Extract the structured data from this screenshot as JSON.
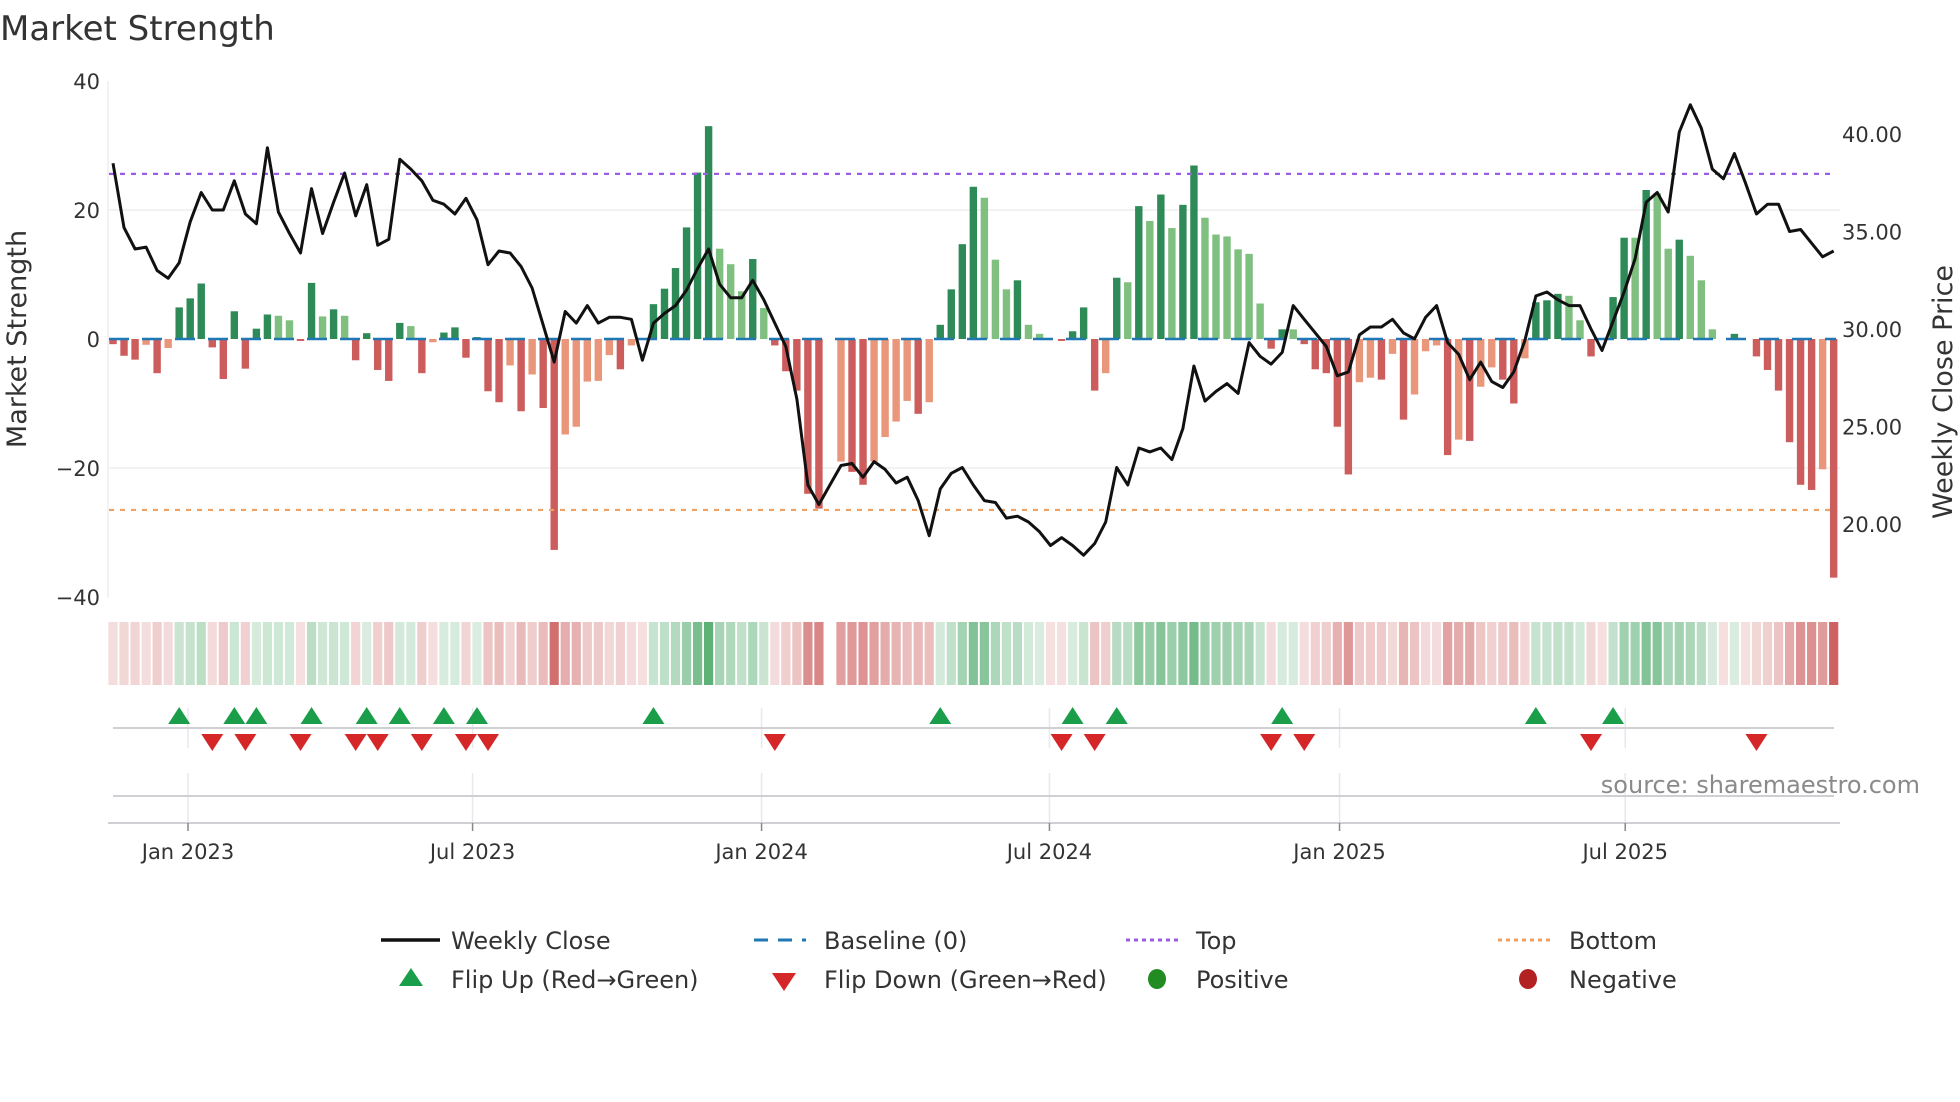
{
  "title": "Market Strength",
  "source": "source: sharemaestro.com",
  "colors": {
    "pos_dark": "#2e8b57",
    "pos_light": "#7fbf7f",
    "neg_dark": "#cd5c5c",
    "neg_light": "#e9967a",
    "line": "#111111",
    "baseline": "#1f77b4",
    "top": "#9b5de5",
    "bottom": "#f0a060",
    "flip_up": "#1a9e4a",
    "flip_down": "#d62728",
    "positive": "#228b22",
    "negative": "#b22222"
  },
  "legend": {
    "weekly_close": "Weekly Close",
    "baseline": "Baseline (0)",
    "top": "Top",
    "bottom": "Bottom",
    "flip_up": "Flip Up (Red→Green)",
    "flip_down": "Flip Down (Green→Red)",
    "positive": "Positive",
    "negative": "Negative"
  },
  "chart_data": {
    "type": "bar+line",
    "title": "Market Strength",
    "ylabel": "Market Strength",
    "ylabel_right": "Weekly Close Price",
    "ylim": [
      -40,
      40
    ],
    "ylim_right": [
      16.2,
      42.7
    ],
    "yticks": [
      "40",
      "20",
      "0",
      "−20",
      "−40"
    ],
    "yticks_values": [
      40,
      20,
      0,
      -20,
      -40
    ],
    "yticks_right": [
      "40.00",
      "35.00",
      "30.00",
      "25.00",
      "20.00"
    ],
    "yticks_right_values": [
      40,
      35,
      30,
      25,
      20
    ],
    "top_level": 25.6,
    "bottom_level": -26.5,
    "x_unit": "week index",
    "xticks": [
      {
        "label": "Jan 2023",
        "week": 6.8
      },
      {
        "label": "Jul 2023",
        "week": 32.6
      },
      {
        "label": "Jan 2024",
        "week": 58.8
      },
      {
        "label": "Jul 2024",
        "week": 84.9
      },
      {
        "label": "Jan 2025",
        "week": 111.2
      },
      {
        "label": "Jul 2025",
        "week": 137.1
      }
    ],
    "strength": [
      -0.8,
      -2.6,
      -3.2,
      -0.9,
      -5.3,
      -1.4,
      4.9,
      6.3,
      8.6,
      -1.3,
      -6.2,
      4.3,
      -4.6,
      1.6,
      3.8,
      3.6,
      2.9,
      -0.3,
      8.7,
      3.5,
      4.6,
      3.6,
      -3.3,
      0.9,
      -4.8,
      -6.5,
      2.5,
      2,
      -5.3,
      -0.5,
      1,
      1.8,
      -2.9,
      0.3,
      -8.1,
      -9.8,
      -4.1,
      -11.2,
      -5.5,
      -10.7,
      -32.7,
      -14.8,
      -13.6,
      -6.6,
      -6.5,
      -2.5,
      -4.7,
      -1,
      0,
      5.4,
      7.8,
      11,
      17.3,
      25.8,
      33,
      14,
      11.6,
      7.4,
      12.4,
      4.8,
      -1,
      -5,
      -8,
      -24,
      -26.3,
      null,
      -19,
      -20.6,
      -22.6,
      -19,
      -15.2,
      -12.8,
      -9.6,
      -11.6,
      -9.8,
      2.2,
      7.7,
      14.7,
      23.6,
      21.9,
      12.3,
      7.7,
      9.1,
      2.2,
      0.8,
      0,
      -0.3,
      1.2,
      4.9,
      -8,
      -5.3,
      9.5,
      8.8,
      20.6,
      18.3,
      22.4,
      17.2,
      20.8,
      26.9,
      18.8,
      16.2,
      15.9,
      13.9,
      13.2,
      5.5,
      -1.5,
      1.5,
      1.5,
      -0.8,
      -4.7,
      -5.3,
      -13.6,
      -21,
      -6.7,
      -6,
      -6.3,
      -2.3,
      -12.5,
      -8.6,
      -1.9,
      -1,
      -18,
      -15.6,
      -15.8,
      -7.4,
      -4.4,
      -6.3,
      -10,
      -3,
      5.7,
      6,
      7,
      6.7,
      2.9,
      -2.7,
      0,
      6.5,
      15.7,
      15.7,
      23.1,
      22.6,
      14,
      15.4,
      12.9,
      9.1,
      1.5,
      0,
      0.8,
      0,
      -2.7,
      -4.8,
      -8,
      -16,
      -22.6,
      -23.4,
      -20.2,
      -37
    ],
    "weekly_close": [
      38.5,
      35.2,
      34.1,
      34.2,
      33.0,
      32.6,
      33.4,
      35.5,
      37.0,
      36.1,
      36.1,
      37.6,
      35.9,
      35.4,
      39.3,
      36.0,
      34.9,
      33.9,
      37.2,
      34.9,
      36.5,
      38.0,
      35.8,
      37.4,
      34.3,
      34.6,
      38.7,
      38.2,
      37.6,
      36.6,
      36.4,
      35.9,
      36.7,
      35.6,
      33.3,
      34.0,
      33.9,
      33.2,
      32.1,
      30.2,
      28.3,
      30.9,
      30.3,
      31.2,
      30.3,
      30.6,
      30.6,
      30.5,
      28.4,
      30.3,
      30.8,
      31.2,
      32.0,
      33.1,
      34.1,
      32.3,
      31.6,
      31.6,
      32.5,
      31.5,
      30.3,
      29.1,
      26.4,
      22.0,
      21.0,
      22.0,
      23.0,
      23.1,
      22.4,
      23.2,
      22.8,
      22.1,
      22.4,
      21.2,
      19.4,
      21.8,
      22.6,
      22.9,
      22.0,
      21.2,
      21.1,
      20.3,
      20.4,
      20.1,
      19.6,
      18.9,
      19.3,
      18.9,
      18.4,
      19.0,
      20.1,
      22.9,
      22.0,
      23.9,
      23.7,
      23.9,
      23.3,
      24.9,
      28.1,
      26.3,
      26.8,
      27.2,
      26.7,
      29.3,
      28.6,
      28.2,
      28.8,
      31.2,
      30.5,
      29.8,
      29.1,
      27.6,
      27.8,
      29.7,
      30.1,
      30.1,
      30.5,
      29.8,
      29.5,
      30.6,
      31.2,
      29.3,
      28.7,
      27.4,
      28.3,
      27.3,
      27.0,
      27.8,
      29.4,
      31.7,
      31.9,
      31.5,
      31.2,
      31.2,
      30.0,
      28.9,
      30.4,
      31.9,
      33.6,
      36.5,
      37.0,
      36.0,
      40.1,
      41.5,
      40.3,
      38.2,
      37.7,
      39.0,
      37.5,
      35.9,
      36.4,
      36.4,
      35.0,
      35.1,
      34.4,
      33.7,
      34.0
    ],
    "legend_position": "bottom-center"
  }
}
